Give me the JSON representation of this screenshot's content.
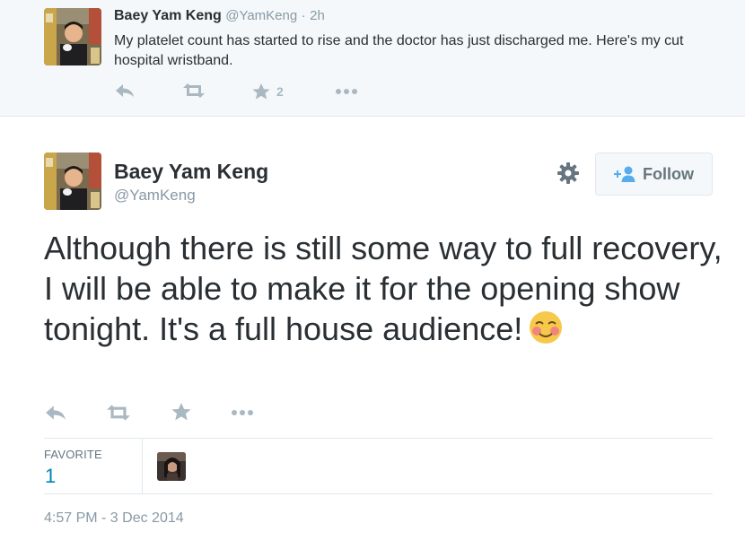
{
  "parent_tweet": {
    "name": "Baey Yam Keng",
    "handle": "@YamKeng",
    "separator": "·",
    "time": "2h",
    "text": "My platelet count has started to rise and the doctor has just discharged me. Here's my cut hospital wristband.",
    "favorite_count": "2",
    "actions": [
      "reply-icon",
      "retweet-icon",
      "favorite-icon",
      "more-icon"
    ]
  },
  "tweet": {
    "name": "Baey Yam Keng",
    "handle": "@YamKeng",
    "follow_label": "Follow",
    "text": "Although there is still some way to full recovery, I will be able to make it for the opening show tonight.  It's a full house audience!",
    "emoji": "smiling-blushing-face-emoji",
    "actions": [
      "reply-icon",
      "retweet-icon",
      "favorite-icon",
      "more-icon"
    ],
    "stats": {
      "favorite_label": "FAVORITE",
      "favorite_count": "1"
    },
    "timestamp": "4:57 PM - 3 Dec 2014"
  },
  "colors": {
    "parent_bg": "#f5f8fa",
    "text": "#292f33",
    "muted": "#8899a6",
    "icon": "#aab8c2",
    "link": "#0084b4",
    "border": "#e1e8ed",
    "follow_icon": "#55acee"
  }
}
